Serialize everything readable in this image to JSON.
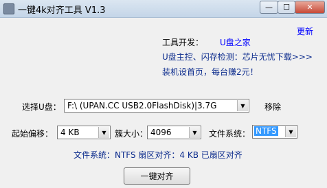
{
  "window": {
    "title": "一键4k对齐工具 V1.3"
  },
  "title_controls": {
    "minimize": "—",
    "maximize": "☐",
    "close": "✕"
  },
  "header": {
    "update_link": "更新",
    "developer_label": "工具开发：",
    "developer_name": "U盘之家",
    "line2": "U盘主控、闪存检测：芯片无忧下载>>>",
    "line3": "装机设首页，每台赚2元！"
  },
  "drive": {
    "label": "选择U盘：",
    "value": "F:\\ (UPAN.CC USB2.0FlashDisk)|3.7G",
    "remove_label": "移除"
  },
  "settings": {
    "offset_label": "起始偏移：",
    "offset_value": "4 KB",
    "cluster_label": "簇大小：",
    "cluster_value": "4096",
    "fs_label": "文件系统：",
    "fs_value": "NTFS"
  },
  "status": {
    "text": "文件系统：NTFS  扇区对齐：4 KB 已扇区对齐"
  },
  "actions": {
    "align_button": "一键对齐"
  },
  "colors": {
    "link": "#0000ff",
    "navy": "#0a2a8c",
    "selection": "#3399ff"
  }
}
